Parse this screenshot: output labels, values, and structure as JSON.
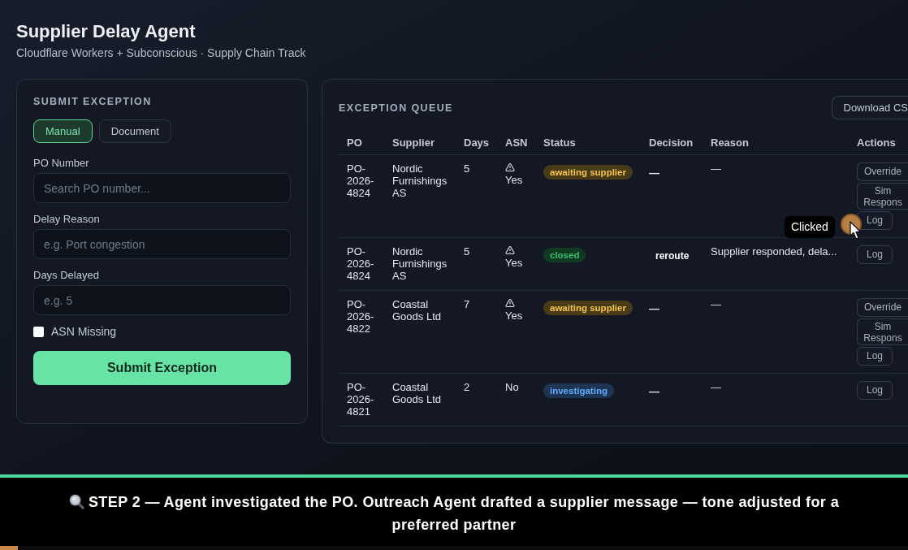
{
  "header": {
    "title": "Supplier Delay Agent",
    "subtitle": "Cloudflare Workers + Subconscious · Supply Chain Track"
  },
  "submit_form": {
    "title": "SUBMIT EXCEPTION",
    "modes": [
      {
        "label": "Manual",
        "selected": true
      },
      {
        "label": "Document",
        "selected": false
      }
    ],
    "fields": [
      {
        "label": "PO Number",
        "placeholder": "Search PO number..."
      },
      {
        "label": "Delay Reason",
        "placeholder": "e.g. Port congestion"
      },
      {
        "label": "Days Delayed",
        "placeholder": "e.g. 5"
      }
    ],
    "asn_missing": {
      "label": "ASN Missing",
      "checked": false
    },
    "submit_button": "Submit Exception"
  },
  "queue": {
    "title": "EXCEPTION QUEUE",
    "download_button": "Download CS",
    "columns": [
      "PO",
      "Supplier",
      "Days",
      "ASN",
      "Status",
      "Decision",
      "Reason",
      "Actions"
    ],
    "rows": [
      {
        "po": "PO-2026-4824",
        "supplier": "Nordic Furnishings AS",
        "days": "5",
        "asn": {
          "label": "Yes",
          "warning": true
        },
        "status": {
          "label": "awaiting supplier",
          "color": "#4a3b18"
        },
        "decision": {
          "kind": "empty",
          "label": "—"
        },
        "reason": "—",
        "actions": [
          {
            "kind": "override",
            "label": "Override"
          },
          {
            "kind": "simulate",
            "label": "Sim Respons"
          },
          {
            "kind": "log",
            "label": "Log"
          }
        ]
      },
      {
        "po": "PO-2026-4824",
        "supplier": "Nordic Furnishings AS",
        "days": "5",
        "asn": {
          "label": "Yes",
          "warning": true
        },
        "status": {
          "label": "closed",
          "color": "#113a22"
        },
        "decision": {
          "kind": "tag",
          "label": "reroute"
        },
        "reason": "Supplier responded, dela...",
        "actions": [
          {
            "kind": "log",
            "label": "Log"
          }
        ]
      },
      {
        "po": "PO-2026-4822",
        "supplier": "Coastal Goods Ltd",
        "days": "7",
        "asn": {
          "label": "Yes",
          "warning": true
        },
        "status": {
          "label": "awaiting supplier",
          "color": "#4a3b18"
        },
        "decision": {
          "kind": "empty",
          "label": "—"
        },
        "reason": "—",
        "actions": [
          {
            "kind": "override",
            "label": "Override"
          },
          {
            "kind": "simulate",
            "label": "Sim Respons"
          },
          {
            "kind": "log",
            "label": "Log"
          }
        ]
      },
      {
        "po": "PO-2026-4821",
        "supplier": "Coastal Goods Ltd",
        "days": "2",
        "asn": {
          "label": "No",
          "warning": false
        },
        "status": {
          "label": "investigating",
          "color": "#1d3452"
        },
        "decision": {
          "kind": "empty",
          "label": "—"
        },
        "reason": "—",
        "actions": [
          {
            "kind": "log",
            "label": "Log"
          }
        ]
      }
    ]
  },
  "cursor_overlay": {
    "tooltip": "Clicked"
  },
  "caption": {
    "text": "STEP 2 — Agent investigated the PO. Outreach Agent drafted a supplier message — tone adjusted for a preferred partner"
  },
  "video_progress": {
    "level": 0.02
  }
}
